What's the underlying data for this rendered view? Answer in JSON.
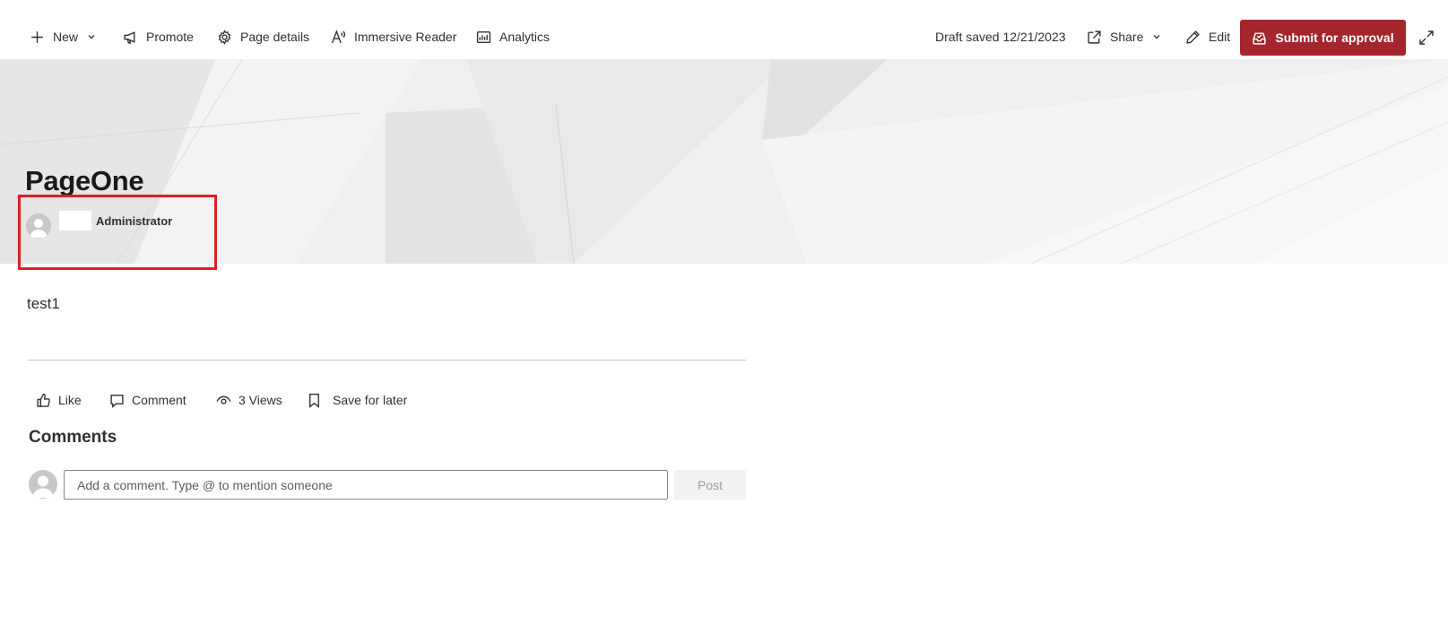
{
  "toolbar": {
    "new_label": "New",
    "promote_label": "Promote",
    "page_details_label": "Page details",
    "immersive_reader_label": "Immersive Reader",
    "analytics_label": "Analytics",
    "draft_status": "Draft saved 12/21/2023",
    "share_label": "Share",
    "edit_label": "Edit",
    "submit_label": "Submit for approval"
  },
  "page": {
    "title": "PageOne",
    "author_name": "Administrator",
    "body_text": "test1"
  },
  "social": {
    "like_label": "Like",
    "comment_label": "Comment",
    "views_label": "3 Views",
    "save_label": "Save for later"
  },
  "comments": {
    "title": "Comments",
    "placeholder": "Add a comment. Type @ to mention someone",
    "post_label": "Post"
  },
  "colors": {
    "accent": "#a4262c",
    "highlight_box": "#e02020"
  },
  "icons": {
    "new": "plus-icon",
    "promote": "megaphone-icon",
    "page_details": "gear-icon",
    "immersive_reader": "immersive-reader-icon",
    "analytics": "analytics-icon",
    "share": "share-icon",
    "edit": "pencil-icon",
    "submit": "inbox-check-icon",
    "expand": "expand-icon",
    "like": "thumbs-up-icon",
    "comment": "comment-icon",
    "views": "eye-icon",
    "save": "bookmark-icon",
    "avatar": "person-icon"
  }
}
